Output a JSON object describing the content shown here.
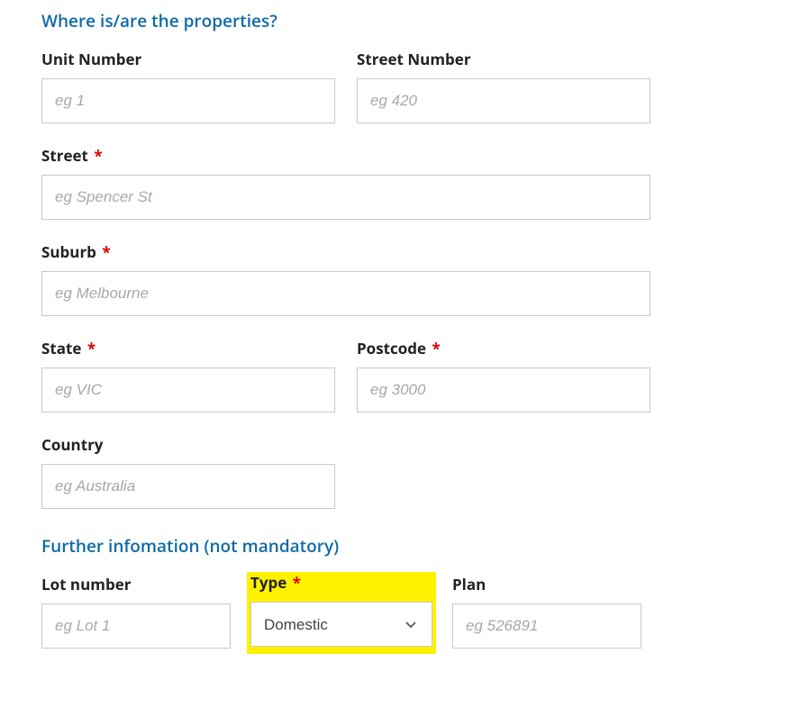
{
  "section1_title": "Where is/are the properties?",
  "section2_title": "Further infomation (not mandatory)",
  "required_mark": "*",
  "fields": {
    "unit_number": {
      "label": "Unit Number",
      "placeholder": "eg 1",
      "value": "",
      "required": false
    },
    "street_number": {
      "label": "Street Number",
      "placeholder": "eg 420",
      "value": "",
      "required": false
    },
    "street": {
      "label": "Street",
      "placeholder": "eg Spencer St",
      "value": "",
      "required": true
    },
    "suburb": {
      "label": "Suburb",
      "placeholder": "eg Melbourne",
      "value": "",
      "required": true
    },
    "state": {
      "label": "State",
      "placeholder": "eg VIC",
      "value": "",
      "required": true
    },
    "postcode": {
      "label": "Postcode",
      "placeholder": "eg 3000",
      "value": "",
      "required": true
    },
    "country": {
      "label": "Country",
      "placeholder": "eg Australia",
      "value": "",
      "required": false
    },
    "lot_number": {
      "label": "Lot number",
      "placeholder": "eg Lot 1",
      "value": "",
      "required": false
    },
    "type": {
      "label": "Type",
      "selected": "Domestic",
      "required": true
    },
    "plan": {
      "label": "Plan",
      "placeholder": "eg 526891",
      "value": "",
      "required": false
    }
  },
  "colors": {
    "accent": "#0e6aa8",
    "required": "#d00",
    "highlight": "#fef200"
  }
}
